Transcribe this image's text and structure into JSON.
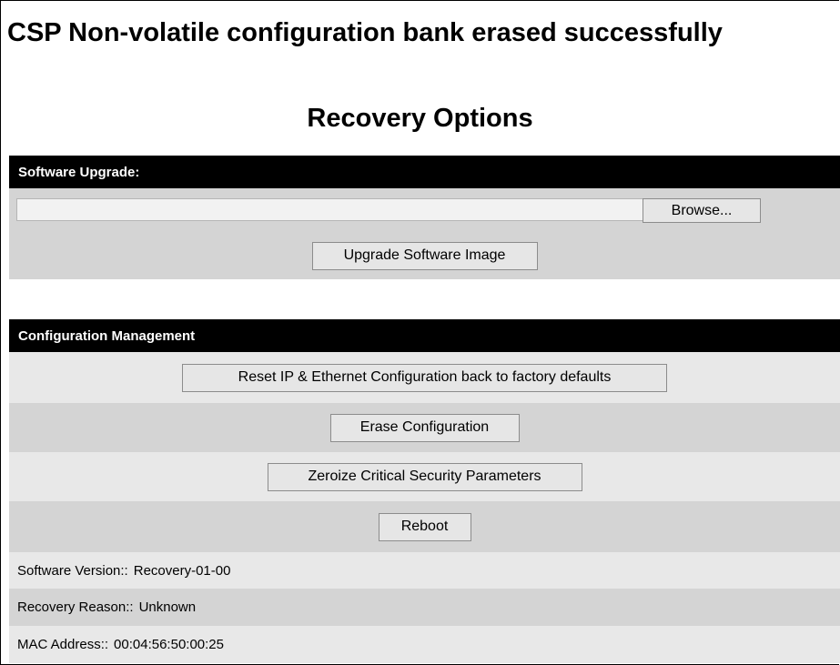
{
  "status_message": "CSP Non-volatile configuration bank erased successfully",
  "page_title": "Recovery Options",
  "software_upgrade": {
    "header": "Software Upgrade:",
    "browse_label": "Browse...",
    "upgrade_label": "Upgrade Software Image"
  },
  "config_management": {
    "header": "Configuration Management",
    "reset_label": "Reset IP & Ethernet Configuration back to factory defaults",
    "erase_label": "Erase Configuration",
    "zeroize_label": "Zeroize Critical Security Parameters",
    "reboot_label": "Reboot"
  },
  "info": {
    "software_version_label": "Software Version::",
    "software_version_value": "Recovery-01-00",
    "recovery_reason_label": "Recovery Reason::",
    "recovery_reason_value": "Unknown",
    "mac_address_label": "MAC Address::",
    "mac_address_value": "00:04:56:50:00:25"
  }
}
